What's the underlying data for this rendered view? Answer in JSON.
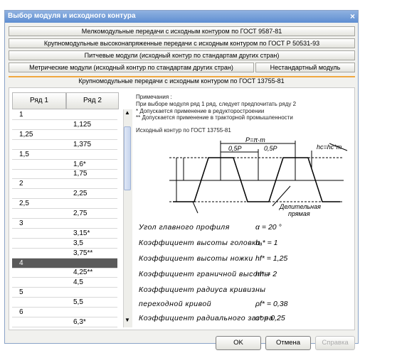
{
  "window": {
    "title": "Выбор модуля и исходного контура",
    "close_glyph": "×"
  },
  "tabs": {
    "row1": "Мелкомодульные передачи с исходным контуром по ГОСТ  9587-81",
    "row2": "Крупномодульные высоконапряженные передачи с исходным контуром по ГОСТ Р 50531-93",
    "row3": "Питчевые модули (исходный контур по стандартам других стран)",
    "row4_left": "Метрические модули (исходный контур по стандартам других стран)",
    "row4_right": "Нестандартный модуль"
  },
  "subtitle": "Крупномодульные передачи с исходным контуром по ГОСТ 13755-81",
  "table": {
    "col1": "Ряд 1",
    "col2": "Ряд 2",
    "rows": [
      {
        "r1": "1",
        "r2": ""
      },
      {
        "r1": "",
        "r2": "1,125"
      },
      {
        "r1": "1,25",
        "r2": ""
      },
      {
        "r1": "",
        "r2": "1,375"
      },
      {
        "r1": "1,5",
        "r2": ""
      },
      {
        "r1": "",
        "r2": "1,6*"
      },
      {
        "r1": "",
        "r2": "1,75"
      },
      {
        "r1": "2",
        "r2": ""
      },
      {
        "r1": "",
        "r2": "2,25"
      },
      {
        "r1": "2,5",
        "r2": ""
      },
      {
        "r1": "",
        "r2": "2,75"
      },
      {
        "r1": "3",
        "r2": ""
      },
      {
        "r1": "",
        "r2": "3,15*"
      },
      {
        "r1": "",
        "r2": "3,5"
      },
      {
        "r1": "",
        "r2": "3,75**"
      },
      {
        "r1": "4",
        "r2": ""
      },
      {
        "r1": "",
        "r2": "4,25**"
      },
      {
        "r1": "",
        "r2": "4,5"
      },
      {
        "r1": "5",
        "r2": ""
      },
      {
        "r1": "",
        "r2": "5,5"
      },
      {
        "r1": "6",
        "r2": ""
      },
      {
        "r1": "",
        "r2": "6,3*"
      }
    ],
    "selected_row": 15
  },
  "notes": {
    "heading": "Примечания :",
    "line1": "При выборе модуля ряд 1 ряд, следует предпочитать ряду 2",
    "line2": "* Допускается применение в редукторостроении",
    "line3": "** Допускается применение в тракторной промышленности"
  },
  "contour_caption": "Исходный контур по ГОСТ 13755-81",
  "diagram": {
    "pitch_label": "P=π·m",
    "half1": "0,5P",
    "half2": "0,5P",
    "hc_label": "hc=hc*m",
    "pitch_line_label_1": "Делительная",
    "pitch_line_label_2": "прямая"
  },
  "params": [
    {
      "label": "Угол главного профиля",
      "value": "α = 20 °"
    },
    {
      "label": "Коэффициент высоты головки",
      "value": "hₐ* = 1"
    },
    {
      "label": "Коэффициент высоты ножки",
      "value": "hf* = 1,25"
    },
    {
      "label": "Коэффициент граничной высоты",
      "value": "hl* = 2"
    },
    {
      "label": "Коэффициент радиуса кривизны",
      "value": ""
    },
    {
      "label": "переходной кривой",
      "value": "ρf* = 0,38"
    },
    {
      "label": "Коэффициент радиального зазора",
      "value": "c* = 0,25"
    }
  ],
  "buttons": {
    "ok": "OK",
    "cancel": "Отмена",
    "help": "Справка"
  }
}
